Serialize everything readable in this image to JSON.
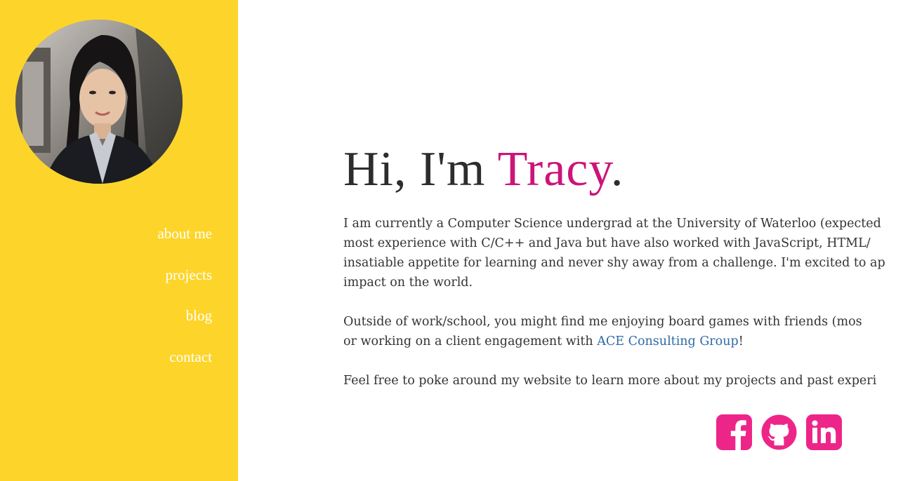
{
  "sidebar": {
    "nav": [
      {
        "label": "about me"
      },
      {
        "label": "projects"
      },
      {
        "label": "blog"
      },
      {
        "label": "contact"
      }
    ]
  },
  "hero": {
    "greeting": "Hi, I'm ",
    "name": "Tracy",
    "punct": "."
  },
  "bio": {
    "p1": [
      "I am currently a Computer Science undergrad at the University of Waterloo (expected",
      "most experience with C/C++ and Java but have also worked with JavaScript, HTML/",
      "insatiable appetite for learning and never shy away from a challenge. I'm excited to ap",
      "impact on the world."
    ],
    "p2_line1": "Outside of work/school, you might find me enjoying board games with friends (mos",
    "p2_line2_before": "or working on a client engagement with ",
    "p2_link": "ACE Consulting Group",
    "p2_line2_after": "!",
    "p3": "Feel free to poke around my website to learn more about my projects and past experi"
  },
  "socials": [
    {
      "icon": "facebook-icon"
    },
    {
      "icon": "github-icon"
    },
    {
      "icon": "linkedin-icon"
    }
  ],
  "colors": {
    "sidebar": "#fdd52a",
    "accent": "#cc1479",
    "icon": "#ee2588",
    "link": "#2d6aa6",
    "text": "#333333"
  }
}
